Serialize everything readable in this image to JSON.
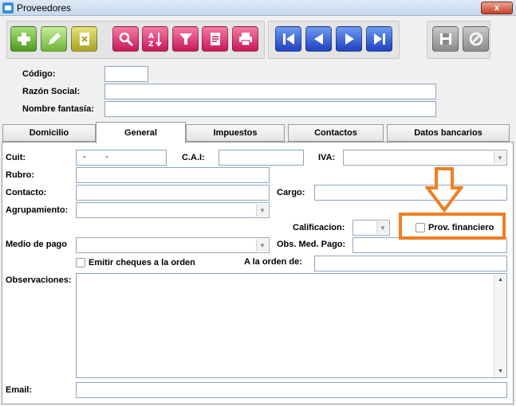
{
  "window": {
    "title": "Proveedores",
    "close_label": "x"
  },
  "toolbar": {
    "buttons": [
      {
        "name": "add-button",
        "icon": "plus-icon",
        "color": "#6cb83a"
      },
      {
        "name": "edit-button",
        "icon": "pencil-icon",
        "color": "#8fc94a"
      },
      {
        "name": "delete-button",
        "icon": "document-x-icon",
        "color": "#c9c243"
      },
      {
        "name": "search-button",
        "icon": "magnifier-icon",
        "color": "#e2356f"
      },
      {
        "name": "sort-button",
        "icon": "sort-az-icon",
        "color": "#e2356f"
      },
      {
        "name": "filter-button",
        "icon": "funnel-icon",
        "color": "#e2356f"
      },
      {
        "name": "report-button",
        "icon": "clipboard-icon",
        "color": "#e2356f"
      },
      {
        "name": "print-button",
        "icon": "printer-icon",
        "color": "#e2356f"
      },
      {
        "name": "first-button",
        "icon": "skip-first-icon",
        "color": "#2f55d4"
      },
      {
        "name": "prev-button",
        "icon": "play-left-icon",
        "color": "#2f55d4"
      },
      {
        "name": "next-button",
        "icon": "play-right-icon",
        "color": "#2f55d4"
      },
      {
        "name": "last-button",
        "icon": "skip-last-icon",
        "color": "#2f55d4"
      },
      {
        "name": "save-button",
        "icon": "floppy-icon",
        "color": "#a0a0a0"
      },
      {
        "name": "cancel-button",
        "icon": "cancel-circle-icon",
        "color": "#a0a0a0"
      }
    ]
  },
  "header": {
    "codigo_label": "Código:",
    "codigo_value": "",
    "razon_label": "Razón Social:",
    "razon_value": "",
    "fantasia_label": "Nombre fantasía:",
    "fantasia_value": ""
  },
  "tabs": [
    "Domicilio",
    "General",
    "Impuestos",
    "Contactos",
    "Datos bancarios"
  ],
  "active_tab": "General",
  "general": {
    "cuit_label": "Cuit:",
    "cuit_value": "-        -",
    "cai_label": "C.A.I:",
    "cai_value": "",
    "iva_label": "IVA:",
    "iva_value": "",
    "rubro_label": "Rubro:",
    "rubro_value": "",
    "contacto_label": "Contacto:",
    "contacto_value": "",
    "cargo_label": "Cargo:",
    "cargo_value": "",
    "agrupamiento_label": "Agrupamiento:",
    "agrupamiento_value": "",
    "calificacion_label": "Calificacion:",
    "calificacion_value": "",
    "prov_financiero_label": "Prov. financiero",
    "prov_financiero_checked": false,
    "medio_pago_label": "Medio de pago",
    "medio_pago_value": "",
    "obs_med_pago_label": "Obs. Med. Pago:",
    "obs_med_pago_value": "",
    "emitir_cheques_label": "Emitir cheques a la orden",
    "emitir_cheques_checked": false,
    "a_la_orden_label": "A la orden de:",
    "a_la_orden_value": "",
    "observaciones_label": "Observaciones:",
    "observaciones_value": "",
    "email_label": "Email:",
    "email_value": ""
  },
  "annotation": {
    "highlight_color": "#f07f22"
  }
}
